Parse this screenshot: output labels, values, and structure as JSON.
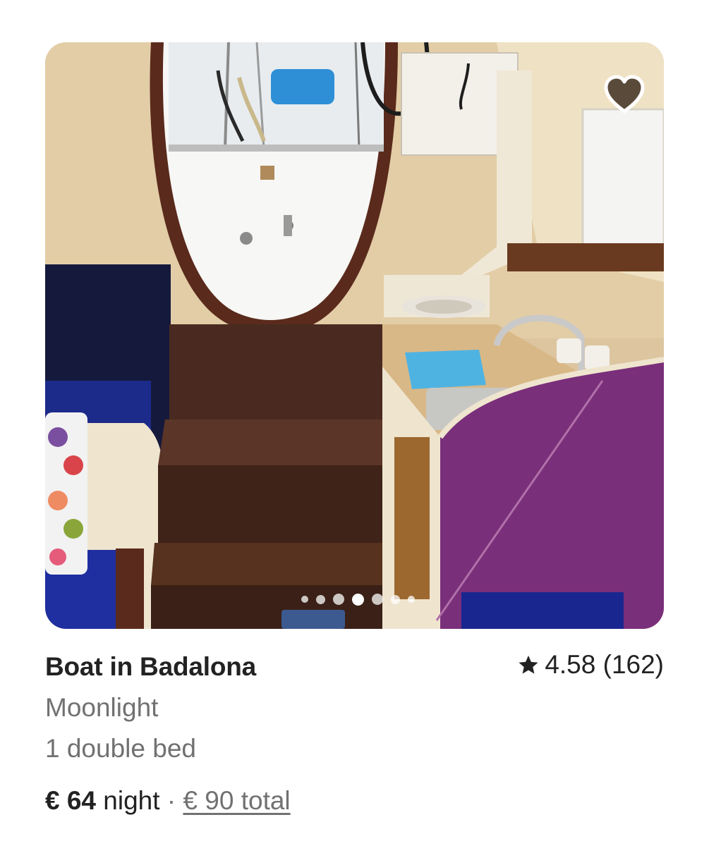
{
  "listing": {
    "title": "Boat in Badalona",
    "name": "Moonlight",
    "beds": "1 double bed",
    "rating": "4.58 (162)",
    "price": "€ 64",
    "price_unit": " night",
    "separator": " · ",
    "total": "€ 90 total"
  },
  "gallery": {
    "photo_count": 7,
    "active_index": 3
  },
  "icons": {
    "favorite": "heart-icon",
    "rating": "star-icon"
  },
  "colors": {
    "text_primary": "#222222",
    "text_secondary": "#717171",
    "heart_fill": "#5a4a3a"
  }
}
